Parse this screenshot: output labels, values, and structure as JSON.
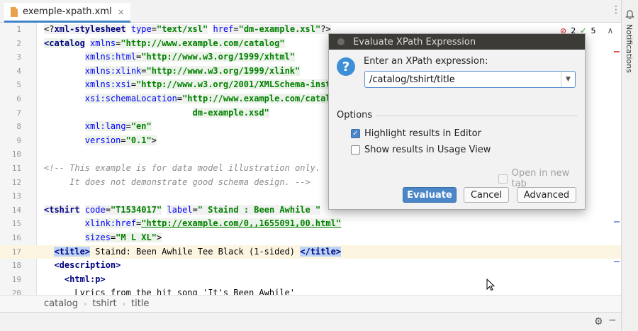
{
  "tab": {
    "title": "exemple-xpath.xml",
    "close": "×"
  },
  "tabmenu_glyph": "⋮",
  "status": {
    "errors": "2",
    "checks": "5",
    "up": "∧",
    "down": "∨"
  },
  "lines": [
    {
      "n": "1",
      "spans": [
        [
          "pl",
          "<?"
        ],
        [
          "tg",
          "xml-stylesheet"
        ],
        [
          "pl",
          " "
        ],
        [
          "an",
          "type"
        ],
        [
          "pl",
          "="
        ],
        [
          "av",
          "\"text/xsl\""
        ],
        [
          "pl",
          " "
        ],
        [
          "an",
          "href"
        ],
        [
          "pl",
          "="
        ],
        [
          "av",
          "\"dm-example.xsl\""
        ],
        [
          "pl",
          "?>"
        ]
      ]
    },
    {
      "n": "2",
      "spans": [
        [
          "tg",
          "<catalog"
        ],
        [
          "pl",
          " "
        ],
        [
          "an",
          "xmlns"
        ],
        [
          "pl",
          "="
        ],
        [
          "av",
          "\"http://www.example.com/catalog\""
        ]
      ]
    },
    {
      "n": "3",
      "spans": [
        [
          "pl",
          "        "
        ],
        [
          "an",
          "xmlns:html"
        ],
        [
          "pl",
          "="
        ],
        [
          "av",
          "\"http://www.w3.org/1999/xhtml\""
        ]
      ]
    },
    {
      "n": "4",
      "spans": [
        [
          "pl",
          "        "
        ],
        [
          "an",
          "xmlns:xlink"
        ],
        [
          "pl",
          "="
        ],
        [
          "av",
          "\"http://www.w3.org/1999/xlink\""
        ]
      ]
    },
    {
      "n": "5",
      "spans": [
        [
          "pl",
          "        "
        ],
        [
          "an",
          "xmlns:xsi"
        ],
        [
          "pl",
          "="
        ],
        [
          "av",
          "\"http://www.w3.org/2001/XMLSchema-inst"
        ]
      ]
    },
    {
      "n": "6",
      "spans": [
        [
          "pl",
          "        "
        ],
        [
          "an",
          "xsi:schemaLocation"
        ],
        [
          "pl",
          "="
        ],
        [
          "av",
          "\"http://www.example.com/catal"
        ]
      ]
    },
    {
      "n": "7",
      "spans": [
        [
          "pl",
          "                             "
        ],
        [
          "av",
          "dm-example.xsd\""
        ]
      ]
    },
    {
      "n": "8",
      "spans": [
        [
          "pl",
          "        "
        ],
        [
          "an",
          "xml:lang"
        ],
        [
          "pl",
          "="
        ],
        [
          "av",
          "\"en\""
        ]
      ]
    },
    {
      "n": "9",
      "spans": [
        [
          "pl",
          "        "
        ],
        [
          "an",
          "version"
        ],
        [
          "pl",
          "="
        ],
        [
          "av",
          "\"0.1\""
        ],
        [
          "pl",
          ">"
        ]
      ]
    },
    {
      "n": "10",
      "spans": []
    },
    {
      "n": "11",
      "spans": [
        [
          "cm",
          "<!-- This example is for data model illustration only."
        ]
      ]
    },
    {
      "n": "12",
      "spans": [
        [
          "cm",
          "     It does not demonstrate good schema design. -->"
        ]
      ]
    },
    {
      "n": "13",
      "spans": []
    },
    {
      "n": "14",
      "spans": [
        [
          "tg",
          "<tshirt"
        ],
        [
          "pl",
          " "
        ],
        [
          "an",
          "code"
        ],
        [
          "pl",
          "="
        ],
        [
          "av",
          "\"T1534017\""
        ],
        [
          "pl",
          " "
        ],
        [
          "an",
          "label"
        ],
        [
          "pl",
          "="
        ],
        [
          "av",
          "\" Staind : Been Awhile \""
        ]
      ]
    },
    {
      "n": "15",
      "spans": [
        [
          "pl",
          "        "
        ],
        [
          "an",
          "xlink:href"
        ],
        [
          "pl",
          "="
        ],
        [
          "ux",
          "\"http://example.com/0,,1655091,00.html\""
        ]
      ]
    },
    {
      "n": "16",
      "spans": [
        [
          "pl",
          "        "
        ],
        [
          "an",
          "sizes"
        ],
        [
          "pl",
          "="
        ],
        [
          "av",
          "\"M L XL\""
        ],
        [
          "pl",
          ">"
        ]
      ]
    },
    {
      "n": "17",
      "spans": [
        [
          "pl",
          "  "
        ],
        [
          "tgsel",
          "<title>"
        ],
        [
          "pl",
          " Staind: Been Awhile Tee Black (1-sided) "
        ],
        [
          "tgsel",
          "</title>"
        ]
      ]
    },
    {
      "n": "18",
      "spans": [
        [
          "pl",
          "  "
        ],
        [
          "tg",
          "<description>"
        ]
      ]
    },
    {
      "n": "19",
      "spans": [
        [
          "pl",
          "    "
        ],
        [
          "tg",
          "<html:p>"
        ]
      ]
    },
    {
      "n": "20",
      "spans": [
        [
          "pl",
          "      Lyrics from the hit song 'It's Been Awhile'"
        ]
      ]
    }
  ],
  "breadcrumb": [
    "catalog",
    "tshirt",
    "title"
  ],
  "breadcrumb_sep": "›",
  "right_panel": {
    "label": "Notifications"
  },
  "dialog": {
    "title": "Evaluate XPath Expression",
    "prompt": "Enter an XPath expression:",
    "expression": "/catalog/tshirt/title",
    "options_label": "Options",
    "highlight_label": "Highlight results in Editor",
    "usage_label": "Show results in Usage View",
    "open_tab_label": "Open in new tab",
    "evaluate": "Evaluate",
    "cancel": "Cancel",
    "advanced": "Advanced",
    "question_glyph": "?",
    "check_glyph": "✓",
    "dropdown_glyph": "▼"
  },
  "bottom": {
    "gear_glyph": "⚙",
    "minus_glyph": "−"
  },
  "colors": {
    "accent": "#4a86c8",
    "current_line": "#fcf5e2",
    "tag": "#000080",
    "attr": "#0000ff",
    "value": "#008000"
  }
}
